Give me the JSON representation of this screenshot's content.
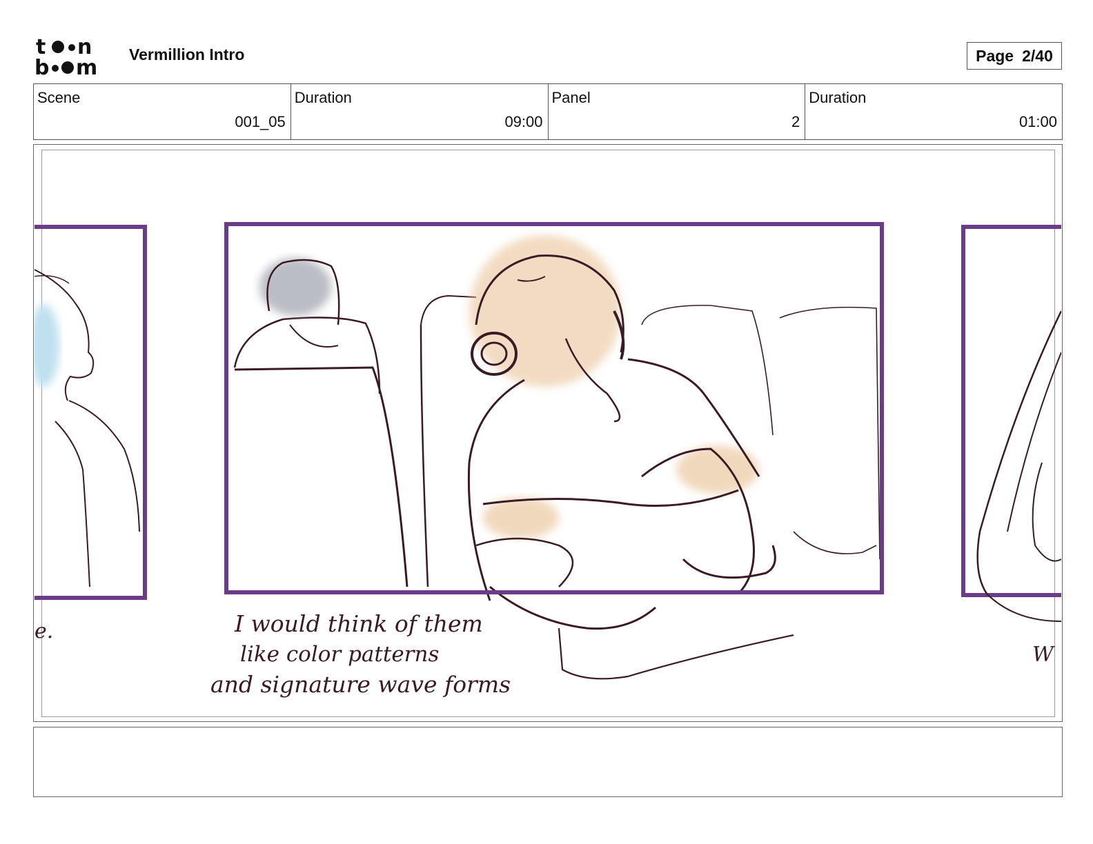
{
  "header": {
    "logo_text_line1": "toon",
    "logo_text_line2": "boom",
    "project_title": "Vermillion Intro",
    "page_label": "Page",
    "page_value": "2/40"
  },
  "info": [
    {
      "label": "Scene",
      "value": "001_05"
    },
    {
      "label": "Duration",
      "value": "09:00"
    },
    {
      "label": "Panel",
      "value": "2"
    },
    {
      "label": "Duration",
      "value": "01:00"
    }
  ],
  "panel": {
    "caption_lines": [
      "I would think of them",
      "like color patterns",
      "and signature wave forms"
    ],
    "left_fragment": "e.",
    "right_fragment": "W",
    "frame_color": "#6b3d88",
    "line_color": "#3a1a24",
    "skin_color": "#e7bf91",
    "hair_gray": "#9ea2aa",
    "accent_blue": "#bfe0ef"
  },
  "notes": {
    "text": ""
  }
}
